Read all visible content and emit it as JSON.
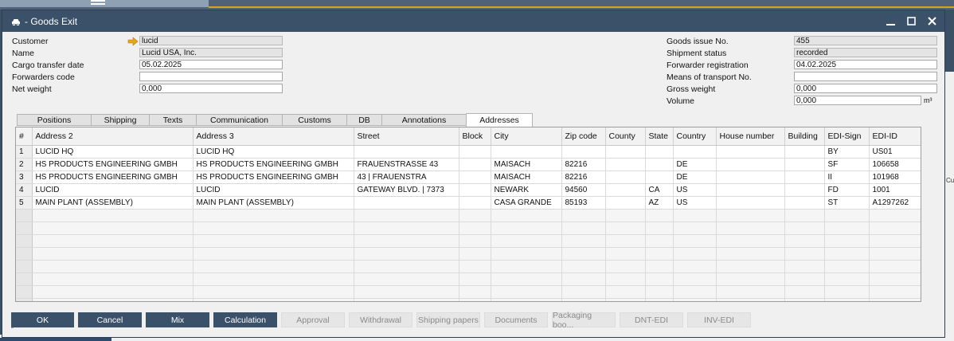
{
  "window": {
    "title": "- Goods Exit"
  },
  "left_fields": [
    {
      "label": "Customer",
      "value": "lucid",
      "readonly": true
    },
    {
      "label": "Name",
      "value": "Lucid USA, Inc.",
      "readonly": true
    },
    {
      "label": "Cargo transfer date",
      "value": "05.02.2025",
      "readonly": false
    },
    {
      "label": "Forwarders code",
      "value": "",
      "readonly": false
    },
    {
      "label": "Net weight",
      "value": "0,000",
      "readonly": false
    }
  ],
  "right_fields": [
    {
      "label": "Goods issue No.",
      "value": "455",
      "readonly": true
    },
    {
      "label": "Shipment status",
      "value": "recorded",
      "readonly": true
    },
    {
      "label": "Forwarder registration",
      "value": "04.02.2025",
      "readonly": false
    },
    {
      "label": "Means of transport No.",
      "value": "",
      "readonly": false
    },
    {
      "label": "Gross weight",
      "value": "0,000",
      "readonly": false
    },
    {
      "label": "Volume",
      "value": "0,000",
      "readonly": false
    }
  ],
  "volume_unit": "m³",
  "tabs": [
    {
      "label": "Positions"
    },
    {
      "label": "Shipping"
    },
    {
      "label": "Texts"
    },
    {
      "label": "Communication"
    },
    {
      "label": "Customs"
    },
    {
      "label": "DB"
    },
    {
      "label": "Annotations"
    },
    {
      "label": "Addresses",
      "active": true
    }
  ],
  "grid": {
    "columns": [
      "#",
      "Address 2",
      "Address 3",
      "Street",
      "Block",
      "City",
      "Zip code",
      "County",
      "State",
      "Country",
      "House number",
      "Building",
      "EDI-Sign",
      "EDI-ID"
    ],
    "rows": [
      [
        "1",
        "LUCID HQ",
        "LUCID HQ",
        "",
        "",
        "",
        "",
        "",
        "",
        "",
        "",
        "",
        "BY",
        "US01"
      ],
      [
        "2",
        "HS PRODUCTS ENGINEERING GMBH",
        "HS PRODUCTS ENGINEERING GMBH",
        "FRAUENSTRASSE 43",
        "",
        "MAISACH",
        "82216",
        "",
        "",
        "DE",
        "",
        "",
        "SF",
        "106658"
      ],
      [
        "3",
        "HS PRODUCTS ENGINEERING GMBH",
        "HS PRODUCTS ENGINEERING GMBH",
        "43 | FRAUENSTRA",
        "",
        "MAISACH",
        "82216",
        "",
        "",
        "DE",
        "",
        "",
        "II",
        "101968"
      ],
      [
        "4",
        "LUCID",
        "LUCID",
        "GATEWAY BLVD. | 7373",
        "",
        "NEWARK",
        "94560",
        "",
        "CA",
        "US",
        "",
        "",
        "FD",
        "1001"
      ],
      [
        "5",
        "MAIN PLANT (ASSEMBLY)",
        "MAIN PLANT (ASSEMBLY)",
        "",
        "",
        "CASA GRANDE",
        "85193",
        "",
        "AZ",
        "US",
        "",
        "",
        "ST",
        "A1297262"
      ]
    ]
  },
  "buttons": [
    {
      "label": "OK",
      "enabled": true
    },
    {
      "label": "Cancel",
      "enabled": true
    },
    {
      "label": "Mix",
      "enabled": true
    },
    {
      "label": "Calculation",
      "enabled": true
    },
    {
      "label": "Approval",
      "enabled": false
    },
    {
      "label": "Withdrawal",
      "enabled": false
    },
    {
      "label": "Shipping papers",
      "enabled": false
    },
    {
      "label": "Documents",
      "enabled": false
    },
    {
      "label": "Packaging boo...",
      "enabled": false
    },
    {
      "label": "DNT-EDI",
      "enabled": false
    },
    {
      "label": "INV-EDI",
      "enabled": false
    }
  ],
  "background": {
    "right_text": "Cu"
  },
  "colors": {
    "titlebar": "#3b5069",
    "accent": "#e0a21c",
    "link_arrow": "#e8a41c"
  }
}
